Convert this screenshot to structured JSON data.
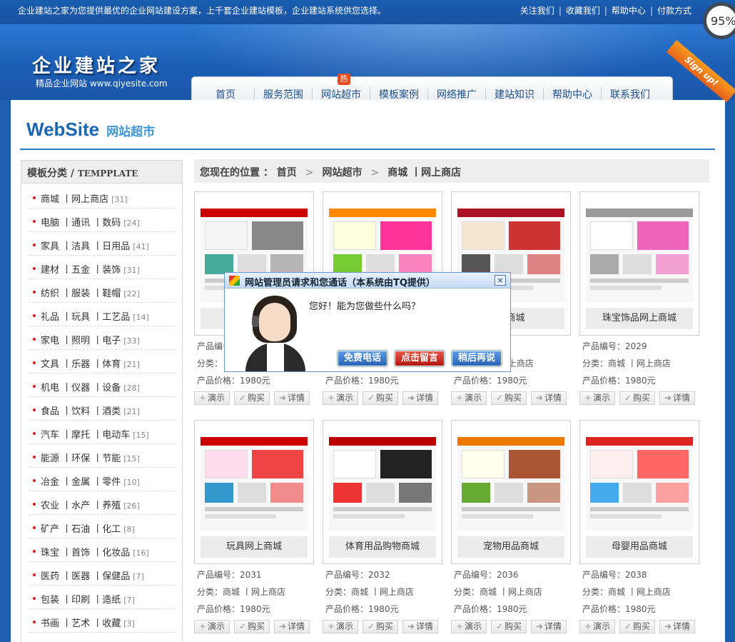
{
  "topbar": {
    "tagline": "企业建站之家为您提供最优的企业网站建设方案，上千套企业建站模板，企业建站系统供您选择。",
    "links": [
      "关注我们",
      "收藏我们",
      "帮助中心",
      "付款方式"
    ]
  },
  "logo": {
    "title": "企业建站之家",
    "subtitle": "精品企业网站 www.qiyesite.com"
  },
  "badge": {
    "percent": "95%",
    "ribbon": "Sign up!"
  },
  "nav": {
    "items": [
      "首页",
      "服务范围",
      "网站超市",
      "模板案例",
      "网络推广",
      "建站知识",
      "帮助中心",
      "联系我们"
    ],
    "hot_label": "热"
  },
  "brand": {
    "title": "WebSite",
    "subtitle": "网站超市"
  },
  "sidebar": {
    "heading": "模板分类 / ",
    "heading_en": "TEMPPLATE",
    "categories": [
      {
        "label": "商城 丨网上商店",
        "count": "[31]"
      },
      {
        "label": "电脑 丨通讯 丨数码",
        "count": "[24]"
      },
      {
        "label": "家具 丨洁具 丨日用品",
        "count": "[41]"
      },
      {
        "label": "建材 丨五金 丨装饰",
        "count": "[31]"
      },
      {
        "label": "纺织 丨服装 丨鞋帽",
        "count": "[22]"
      },
      {
        "label": "礼品 丨玩具 丨工艺品",
        "count": "[14]"
      },
      {
        "label": "家电 丨照明 丨电子",
        "count": "[33]"
      },
      {
        "label": "文具 丨乐器 丨体育",
        "count": "[21]"
      },
      {
        "label": "机电 丨仪器 丨设备",
        "count": "[28]"
      },
      {
        "label": "食品 丨饮料 丨酒类",
        "count": "[21]"
      },
      {
        "label": "汽车 丨摩托 丨电动车",
        "count": "[15]"
      },
      {
        "label": "能源 丨环保 丨节能",
        "count": "[15]"
      },
      {
        "label": "冶金 丨金属 丨零件",
        "count": "[10]"
      },
      {
        "label": "农业 丨水产 丨养殖",
        "count": "[26]"
      },
      {
        "label": "矿产 丨石油 丨化工",
        "count": "[8]"
      },
      {
        "label": "珠宝 丨首饰 丨化妆品",
        "count": "[16]"
      },
      {
        "label": "医药 丨医器 丨保健品",
        "count": "[7]"
      },
      {
        "label": "包装 丨印刷 丨造纸",
        "count": "[7]"
      },
      {
        "label": "书画 丨艺术 丨收藏",
        "count": "[3]"
      }
    ]
  },
  "breadcrumb": {
    "prefix": "您现在的位置 ：",
    "items": [
      "首页",
      "网站超市",
      "商城 丨网上商店"
    ]
  },
  "labels": {
    "code": "产品编号：",
    "category": "分类：",
    "price": "产品价格：",
    "demo": "演示",
    "buy": "购买",
    "detail": "详情"
  },
  "products": [
    {
      "name": "",
      "code": "",
      "category": "",
      "price": "1980元"
    },
    {
      "name": "",
      "code": "",
      "category": "",
      "price": "1980元"
    },
    {
      "name": "品商城",
      "code": "5",
      "category": "城 丨网上商店",
      "price": "1980元"
    },
    {
      "name": "珠宝饰品网上商城",
      "code": "2029",
      "category": "商城 丨网上商店",
      "price": "1980元"
    },
    {
      "name": "玩具网上商城",
      "code": "2031",
      "category": "商城 丨网上商店",
      "price": "1980元"
    },
    {
      "name": "体育用品购物商城",
      "code": "2032",
      "category": "商城 丨网上商店",
      "price": "1980元"
    },
    {
      "name": "宠物用品商城",
      "code": "2036",
      "category": "商城 丨网上商店",
      "price": "1980元"
    },
    {
      "name": "母婴用品商城",
      "code": "2038",
      "category": "商城 丨网上商店",
      "price": "1980元"
    }
  ],
  "dialog": {
    "title": "网站管理员请求和您通话（本系统由TQ提供）",
    "greeting": "您好！能为您做些什么吗？",
    "buttons": [
      "免费电话",
      "点击留言",
      "稍后再说"
    ],
    "close": "×"
  },
  "colors": {
    "brand_blue": "#1a66b5",
    "accent_red": "#d91c1c",
    "hot_orange": "#e8491d"
  }
}
